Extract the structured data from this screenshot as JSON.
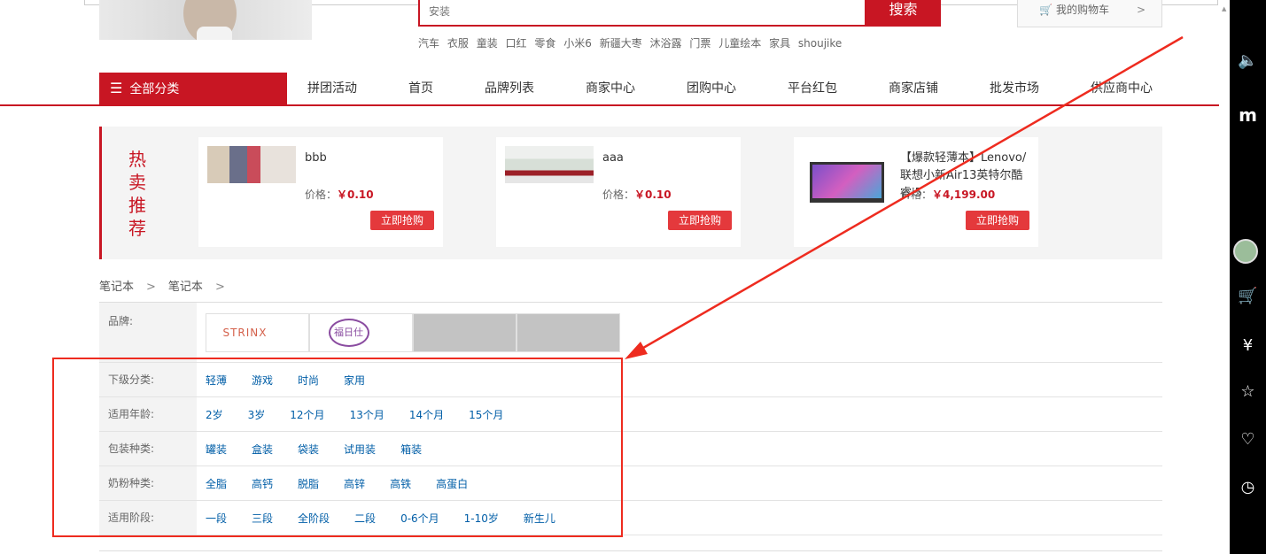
{
  "header": {
    "search_placeholder": "安装",
    "search_button": "搜索",
    "cart_label": "我的购物车",
    "hot_words": [
      "汽车",
      "衣服",
      "童装",
      "口红",
      "零食",
      "小米6",
      "新疆大枣",
      "沐浴露",
      "门票",
      "儿童绘本",
      "家具",
      "shoujike"
    ]
  },
  "nav": {
    "all_categories": "全部分类",
    "items": [
      "拼团活动",
      "首页",
      "品牌列表",
      "商家中心",
      "团购中心",
      "平台红包",
      "商家店铺",
      "批发市场",
      "供应商中心"
    ]
  },
  "hot": {
    "title_chars": [
      "热",
      "卖",
      "推",
      "荐"
    ],
    "products": [
      {
        "name": "bbb",
        "price_label": "价格：",
        "price": "￥0.10",
        "buy": "立即抢购"
      },
      {
        "name": "aaa",
        "price_label": "价格：",
        "price": "￥0.10",
        "buy": "立即抢购"
      },
      {
        "name": "【爆款轻薄本】Lenovo/联想小新Air13英特尔酷睿i5",
        "price_label": "价格：",
        "price": "￥4,199.00",
        "buy": "立即抢购"
      }
    ]
  },
  "breadcrumb": [
    "笔记本",
    "笔记本"
  ],
  "filter": {
    "brand_label": "品牌:",
    "brands": [
      "STRINX",
      "福日仕"
    ],
    "rows": [
      {
        "label": "下级分类:",
        "values": [
          "轻薄",
          "游戏",
          "时尚",
          "家用"
        ]
      },
      {
        "label": "适用年龄:",
        "values": [
          "2岁",
          "3岁",
          "12个月",
          "13个月",
          "14个月",
          "15个月"
        ]
      },
      {
        "label": "包装种类:",
        "values": [
          "罐装",
          "盒装",
          "袋装",
          "试用装",
          "箱装"
        ]
      },
      {
        "label": "奶粉种类:",
        "values": [
          "全脂",
          "高钙",
          "脱脂",
          "高锌",
          "高铁",
          "高蛋白"
        ]
      },
      {
        "label": "适用阶段:",
        "values": [
          "一段",
          "三段",
          "全阶段",
          "二段",
          "0-6个月",
          "1-10岁",
          "新生儿"
        ]
      }
    ]
  },
  "colors": {
    "accent": "#c81623",
    "link": "#005ea7",
    "annotation": "#ee2b1f"
  },
  "sidebar_icons": [
    "speaker-icon",
    "m-logo-icon",
    "avatar",
    "cart-icon",
    "yen-icon",
    "star-icon",
    "heart-icon",
    "history-icon"
  ]
}
